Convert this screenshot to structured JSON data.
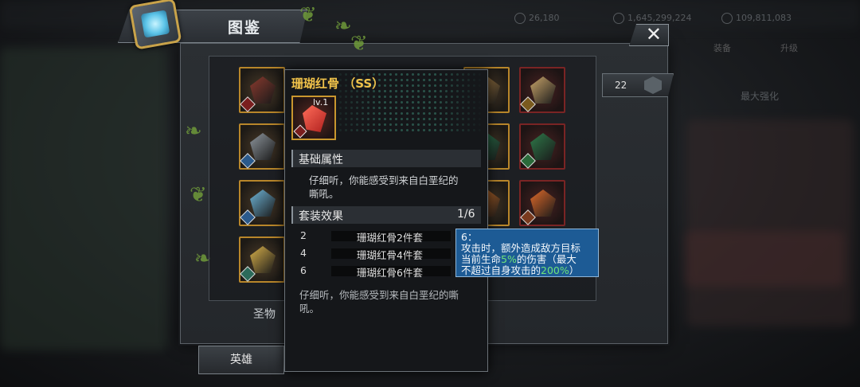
{
  "window": {
    "title": "图鉴",
    "close_glyph": "✕"
  },
  "background": {
    "stats": [
      "26,180",
      "1,645,299,224",
      "109,811,083"
    ],
    "tabs": [
      "装备",
      "升级"
    ],
    "blurred_label": "最大强化"
  },
  "collection": {
    "count": "22",
    "bottom_label": "圣物",
    "hero_tab": "英雄",
    "cells": [
      {
        "col": 0,
        "row": 0,
        "frame": "gold",
        "gem": "#8a3a2e",
        "tag": "#7a1e1e"
      },
      {
        "col": 0,
        "row": 1,
        "frame": "gold",
        "gem": "#8f979e",
        "tag": "#2b5a8c"
      },
      {
        "col": 0,
        "row": 2,
        "frame": "gold",
        "gem": "#6fb6d8",
        "tag": "#2b5a8c"
      },
      {
        "col": 0,
        "row": 3,
        "frame": "gold",
        "gem": "#d8b04a",
        "tag": "#2b6a5a"
      },
      {
        "col": 4,
        "row": 0,
        "frame": "gold",
        "gem": "#b88a4a",
        "tag": "#7a5a1e"
      },
      {
        "col": 5,
        "row": 0,
        "frame": "red",
        "gem": "#c9a56a",
        "tag": "#7a5a1e"
      },
      {
        "col": 4,
        "row": 1,
        "frame": "gold",
        "gem": "#2f8a5a",
        "tag": "#2b6a3a"
      },
      {
        "col": 5,
        "row": 1,
        "frame": "red",
        "gem": "#2f7a4a",
        "tag": "#2b6a3a"
      },
      {
        "col": 4,
        "row": 2,
        "frame": "gold",
        "gem": "#d8762a",
        "tag": "#7a3a1e"
      },
      {
        "col": 5,
        "row": 2,
        "frame": "red",
        "gem": "#e06a2a",
        "tag": "#7a3a1e"
      }
    ]
  },
  "detail": {
    "name": "珊瑚红骨 （SS）",
    "level": "lv.1",
    "base_header": "基础属性",
    "description": "仔细听，你能感受到来自白垩纪的嘶吼。",
    "set_header": "套装效果",
    "set_progress": "1/6",
    "set_rows": [
      {
        "num": "2",
        "label": "珊瑚红骨2件套"
      },
      {
        "num": "4",
        "label": "珊瑚红骨4件套"
      },
      {
        "num": "6",
        "label": "珊瑚红骨6件套"
      }
    ],
    "footer": "仔细听，你能感受到来自白垩纪的嘶吼。"
  },
  "effect_tip": {
    "heading": "6：",
    "line1": "攻击时，额外造成敌方目标",
    "line2_pre": "当前生命",
    "line2_hl": "5%",
    "line2_post": "的伤害（最大",
    "line3_pre": "不超过自身攻击的",
    "line3_hl": "200%",
    "line3_post": "）"
  }
}
